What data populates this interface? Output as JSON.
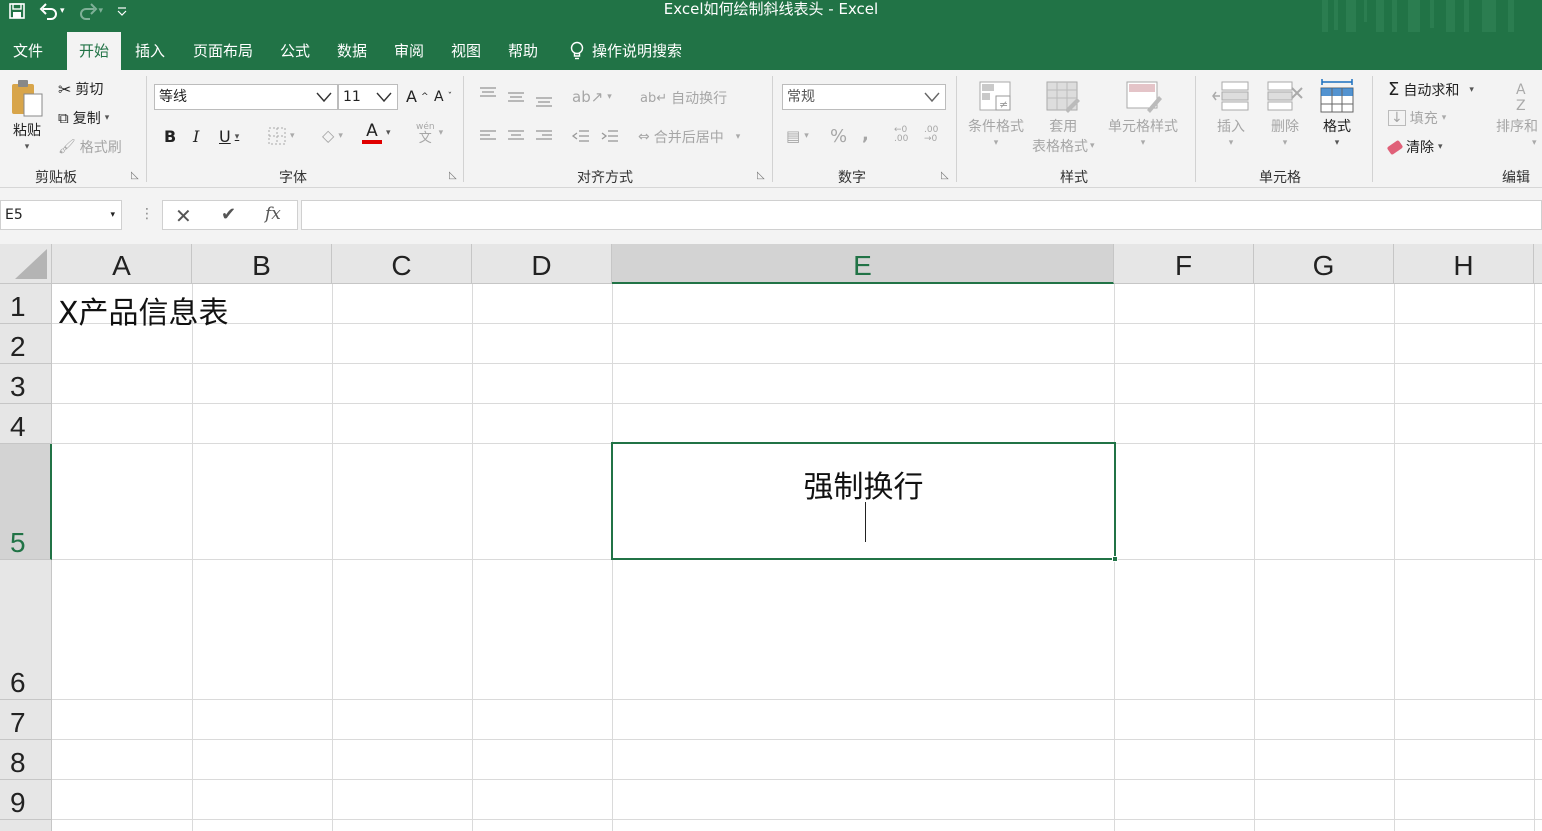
{
  "window": {
    "title": "Excel如何绘制斜线表头 - Excel"
  },
  "qat": {
    "save": "save-icon",
    "undo": "undo-icon",
    "redo": "redo-icon",
    "customize": "customize-icon"
  },
  "menu": {
    "tabs": [
      "文件",
      "开始",
      "插入",
      "页面布局",
      "公式",
      "数据",
      "审阅",
      "视图",
      "帮助"
    ],
    "active": "开始",
    "tell_me": "操作说明搜索"
  },
  "ribbon": {
    "clipboard": {
      "label": "剪贴板",
      "paste": "粘贴",
      "cut": "剪切",
      "copy": "复制",
      "format_painter": "格式刷"
    },
    "font": {
      "label": "字体",
      "font_name": "等线",
      "font_size": "11",
      "grow": "A",
      "shrink": "A",
      "bold": "B",
      "italic": "I",
      "underline": "U",
      "font_color": "A",
      "phonetic_top": "wén",
      "phonetic_bottom": "文"
    },
    "alignment": {
      "label": "对齐方式",
      "wrap_text": "自动换行",
      "merge_center": "合并后居中"
    },
    "number": {
      "label": "数字",
      "format": "常规",
      "percent": "%",
      "comma": ","
    },
    "styles": {
      "label": "样式",
      "conditional": "条件格式",
      "table_line1": "套用",
      "table_line2": "表格格式",
      "cell_styles": "单元格样式"
    },
    "cells": {
      "label": "单元格",
      "insert": "插入",
      "delete": "删除",
      "format": "格式"
    },
    "editing": {
      "label": "编辑",
      "autosum": "自动求和",
      "fill": "填充",
      "clear": "清除",
      "sort": "排序和"
    }
  },
  "formula_bar": {
    "name_box": "E5",
    "formula": "",
    "fx": "fx"
  },
  "sheet": {
    "columns": [
      "A",
      "B",
      "C",
      "D",
      "E",
      "F",
      "G",
      "H"
    ],
    "rows": [
      "1",
      "2",
      "3",
      "4",
      "5",
      "6",
      "7",
      "8",
      "9"
    ],
    "selected_column": "E",
    "selected_row": "5",
    "cells": {
      "A1": "X产品信息表",
      "E5": "强制换行"
    }
  },
  "colors": {
    "accent": "#217346",
    "font_red": "#e00000"
  }
}
